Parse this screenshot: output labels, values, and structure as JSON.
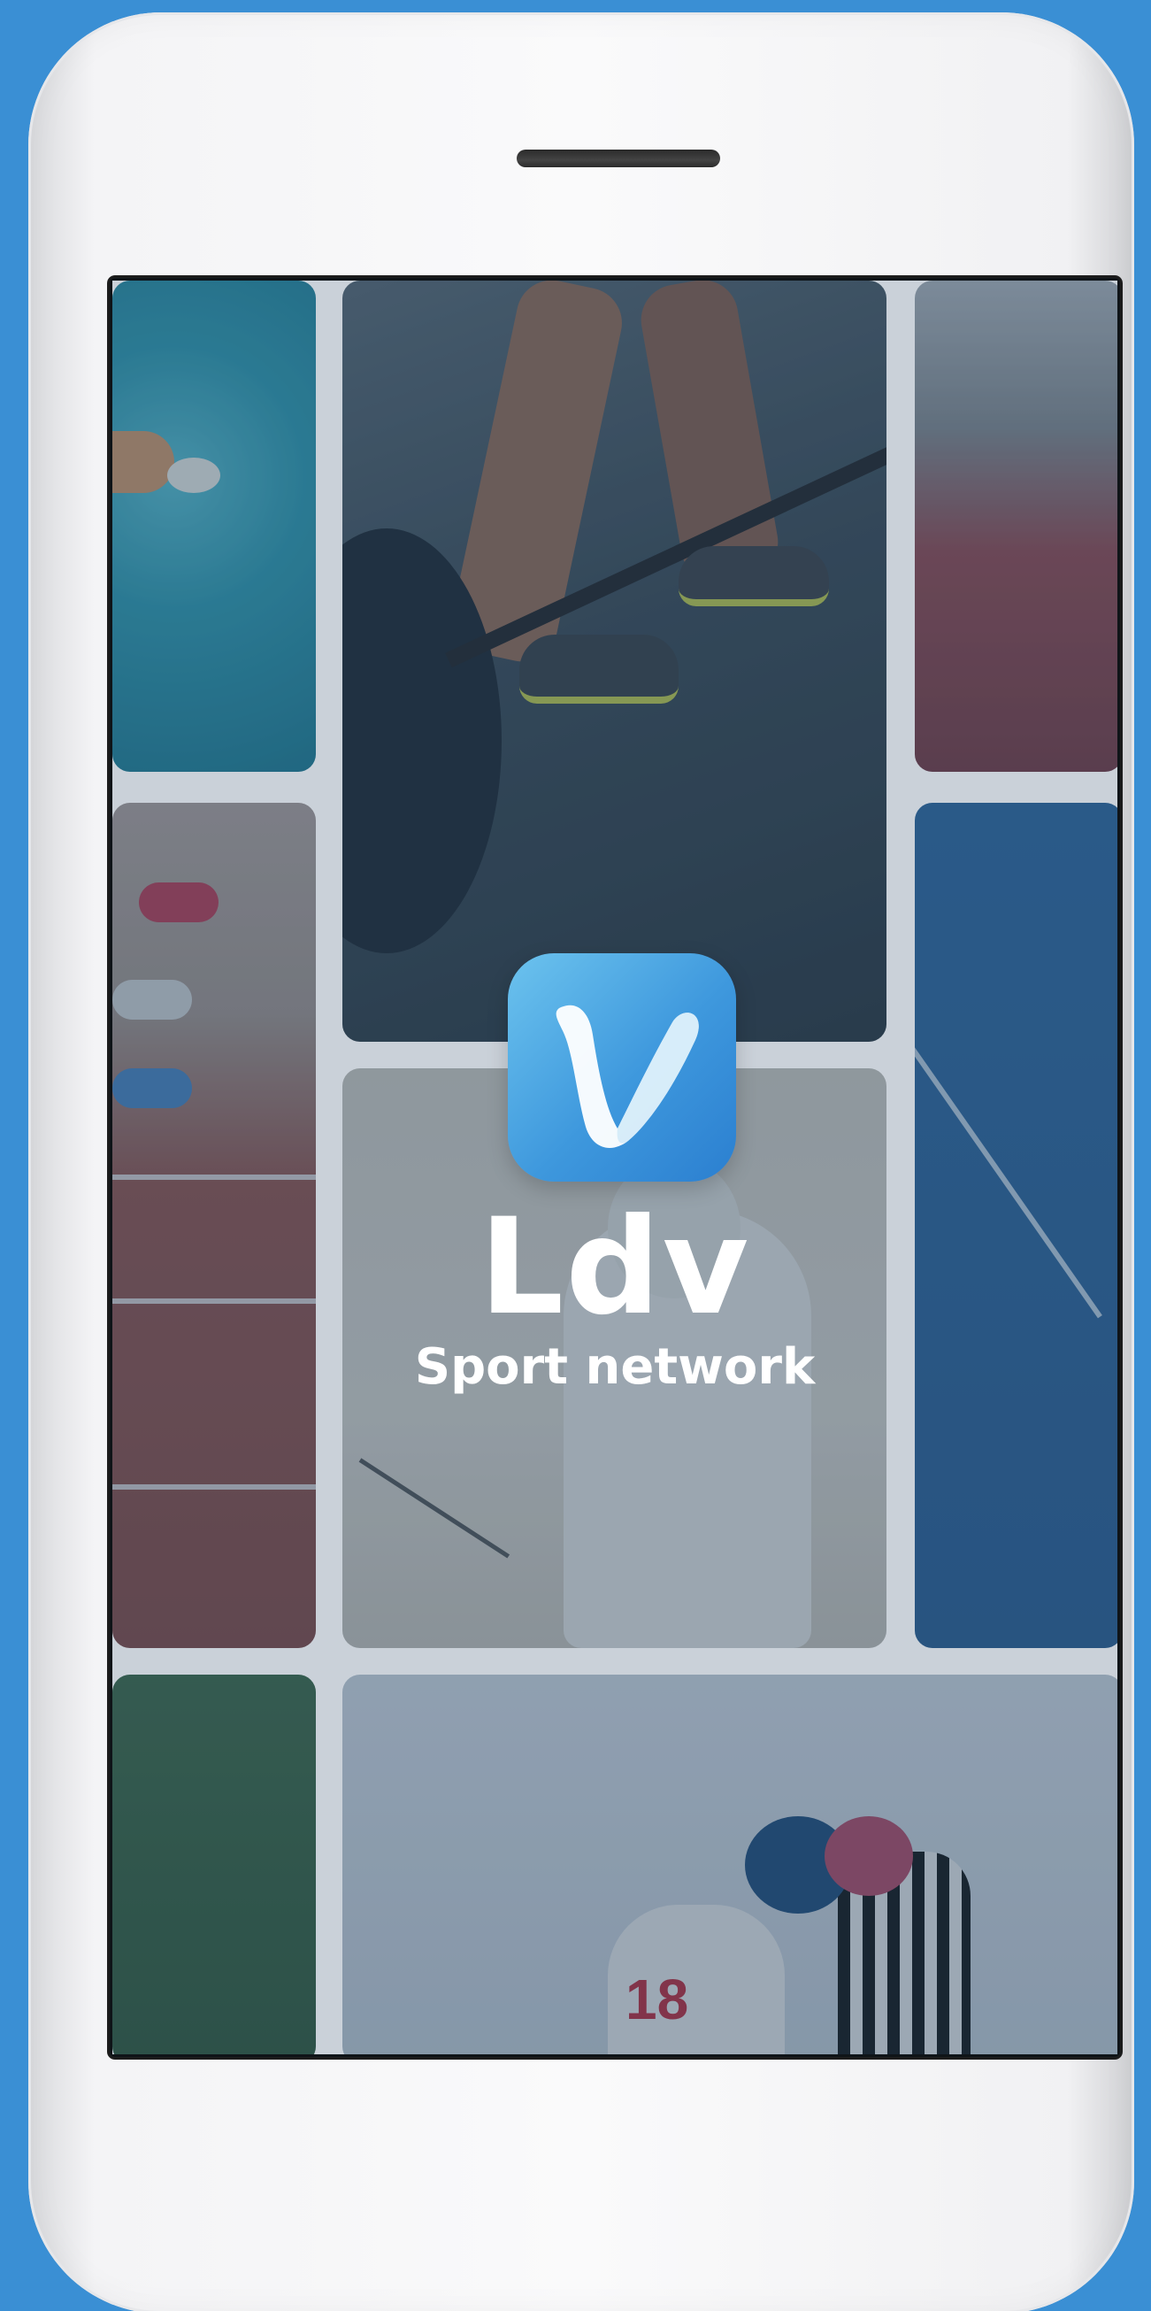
{
  "app": {
    "title": "Ldv",
    "subtitle": "Sport network",
    "icon": "v-logo-icon"
  },
  "colors": {
    "background": "#3a8fd4",
    "icon_gradient_start": "#6cc3ee",
    "icon_gradient_end": "#2b7fd0",
    "text": "#ffffff"
  },
  "tiles": [
    {
      "name": "swimming-pool-photo"
    },
    {
      "name": "weightlifting-photo"
    },
    {
      "name": "stadium-photo"
    },
    {
      "name": "running-track-photo"
    },
    {
      "name": "blue-court-photo"
    },
    {
      "name": "fencing-photo"
    },
    {
      "name": "grass-field-photo"
    },
    {
      "name": "ice-hockey-photo"
    }
  ],
  "hockey_jersey_number": "18"
}
